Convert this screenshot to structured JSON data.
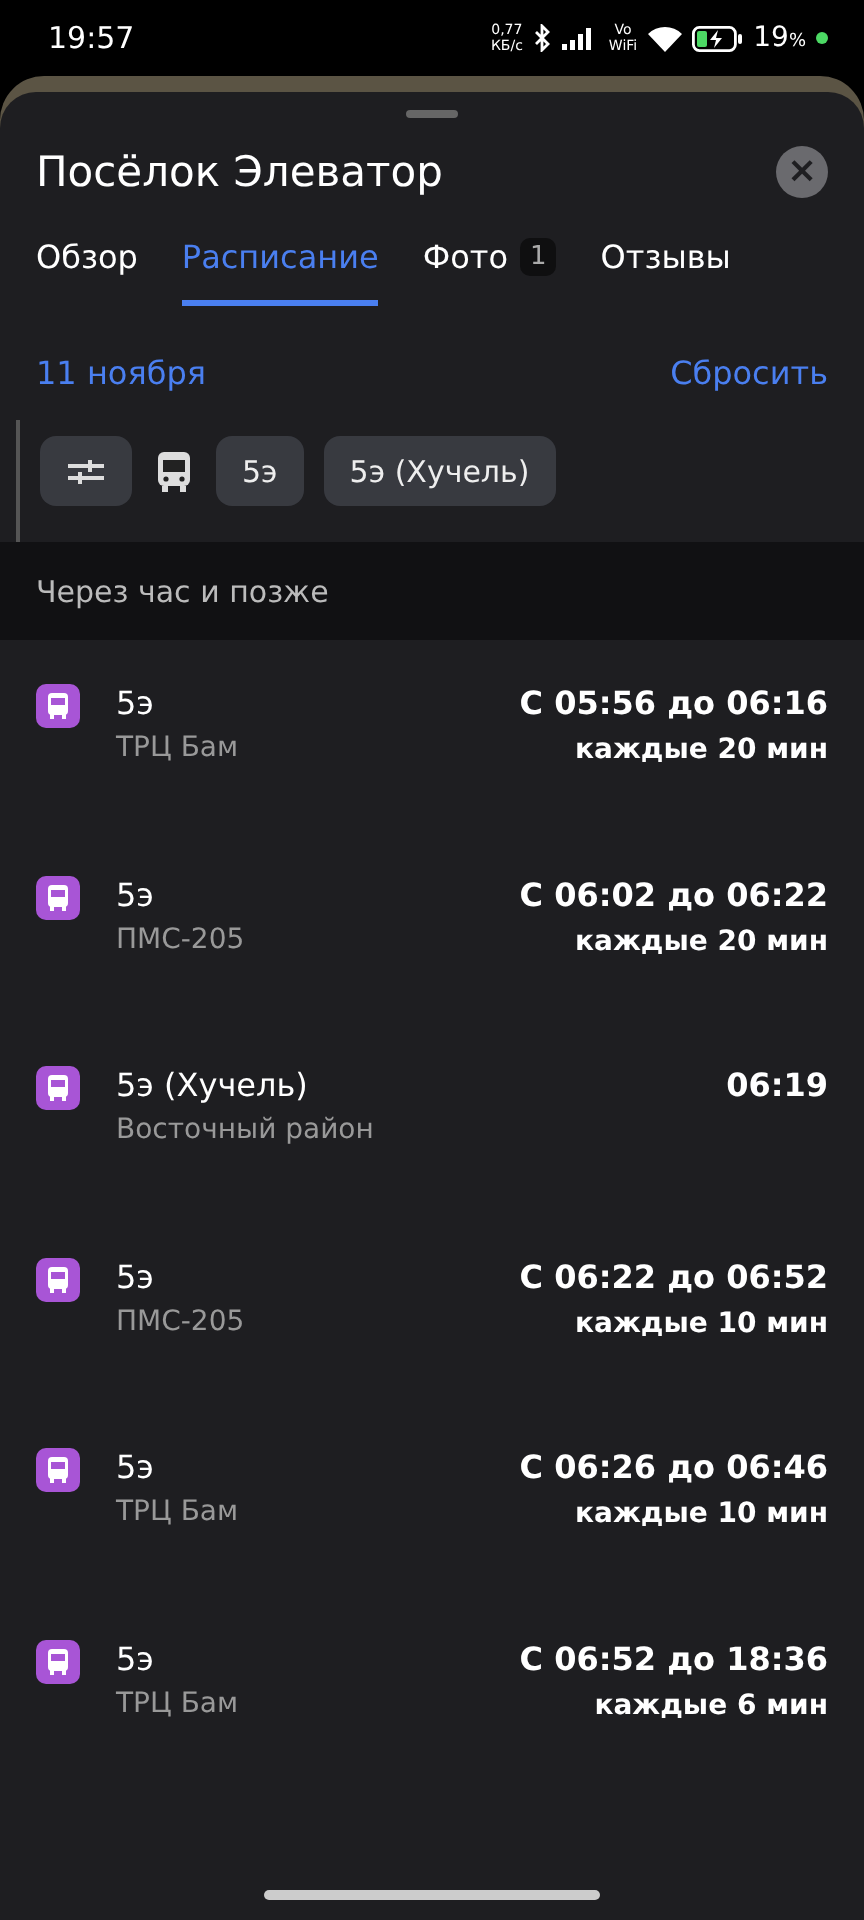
{
  "status_bar": {
    "time": "19:57",
    "speed": "0,77",
    "speed_unit": "КБ/с",
    "volte_top": "Vo",
    "volte_bottom": "WiFi",
    "battery": "19",
    "battery_unit": "%"
  },
  "sheet": {
    "title": "Посёлок Элеватор",
    "close": "×"
  },
  "tabs": [
    {
      "label": "Обзор",
      "selected": false
    },
    {
      "label": "Расписание",
      "selected": true
    },
    {
      "label": "Фото",
      "selected": false,
      "badge": "1"
    },
    {
      "label": "Отзывы",
      "selected": false
    }
  ],
  "date": "11 ноября",
  "reset": "Сбросить",
  "filters": [
    {
      "kind": "settings"
    },
    {
      "kind": "bus"
    },
    {
      "kind": "chip",
      "label": "5э"
    },
    {
      "kind": "chip",
      "label": "5э (Хучель)"
    }
  ],
  "section": "Через час и позже",
  "rows": [
    {
      "route": "5э",
      "stop": "ТРЦ Бам",
      "time": "С 05:56 до 06:16",
      "interval": "каждые 20 мин"
    },
    {
      "route": "5э",
      "stop": "ПМС-205",
      "time": "С 06:02 до 06:22",
      "interval": "каждые 20 мин"
    },
    {
      "route": "5э (Хучель)",
      "stop": "Восточный район",
      "time": "06:19"
    },
    {
      "route": "5э",
      "stop": "ПМС-205",
      "time": "С 06:22 до 06:52",
      "interval": "каждые 10 мин"
    },
    {
      "route": "5э",
      "stop": "ТРЦ Бам",
      "time": "С 06:26 до 06:46",
      "interval": "каждые 10 мин"
    },
    {
      "route": "5э",
      "stop": "ТРЦ Бам",
      "time": "С 06:52 до 18:36",
      "interval": "каждые 6 мин"
    }
  ]
}
